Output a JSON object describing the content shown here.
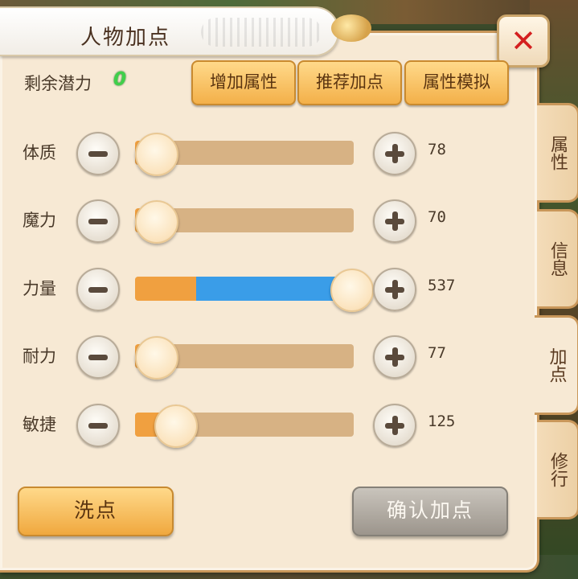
{
  "window": {
    "title": "人物加点"
  },
  "potential": {
    "label": "剩余潜力",
    "value": "0"
  },
  "toolbar": {
    "add_attr": "增加属性",
    "recommend": "推荐加点",
    "simulate": "属性模拟"
  },
  "attributes": [
    {
      "label": "体质",
      "value": "78",
      "fill_fraction": 0.06
    },
    {
      "label": "魔力",
      "value": "70",
      "fill_fraction": 0.04
    },
    {
      "label": "力量",
      "value": "537",
      "fill_fraction": 0.985,
      "base_fraction": 0.28
    },
    {
      "label": "耐力",
      "value": "77",
      "fill_fraction": 0.05
    },
    {
      "label": "敏捷",
      "value": "125",
      "fill_fraction": 0.18
    }
  ],
  "side_tabs": [
    {
      "label": "属性"
    },
    {
      "label": "信息"
    },
    {
      "label": "加点",
      "active": true
    },
    {
      "label": "修行"
    }
  ],
  "footer": {
    "wash": "洗点",
    "confirm": "确认加点"
  },
  "colors": {
    "accent": "#f0a040",
    "slider_blue": "#3a9de8",
    "close": "#d42020",
    "potential": "#3fd04a"
  }
}
